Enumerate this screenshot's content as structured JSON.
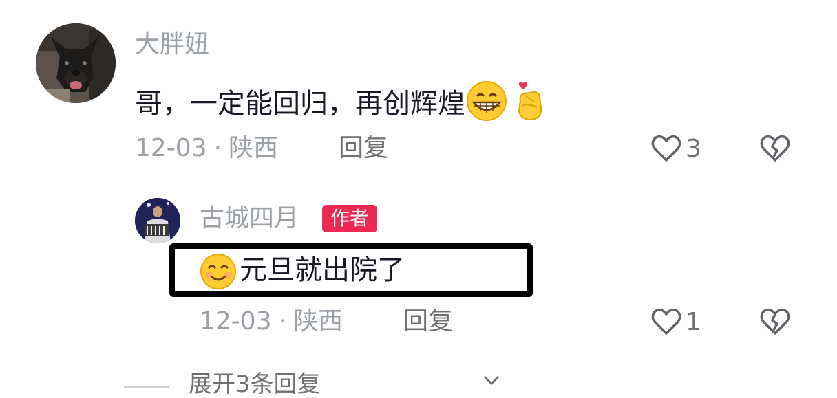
{
  "comment": {
    "username": "大胖妞",
    "text": "哥，一定能回归，再创辉煌",
    "emoji_1": "grinning-face-emoji",
    "emoji_2": "finger-heart-emoji",
    "date": "12-03",
    "separator": "·",
    "location": "陕西",
    "reply_label": "回复",
    "likes": "3"
  },
  "reply": {
    "username": "古城四月",
    "badge": "作者",
    "emoji": "smiling-face-emoji",
    "text": "元旦就出院了",
    "date": "12-03",
    "separator": "·",
    "location": "陕西",
    "reply_label": "回复",
    "likes": "1"
  },
  "expand": {
    "label": "展开3条回复"
  },
  "colors": {
    "meta_gray": "#9aa0a6",
    "author_badge": "#ee2a53",
    "text": "#161823"
  }
}
